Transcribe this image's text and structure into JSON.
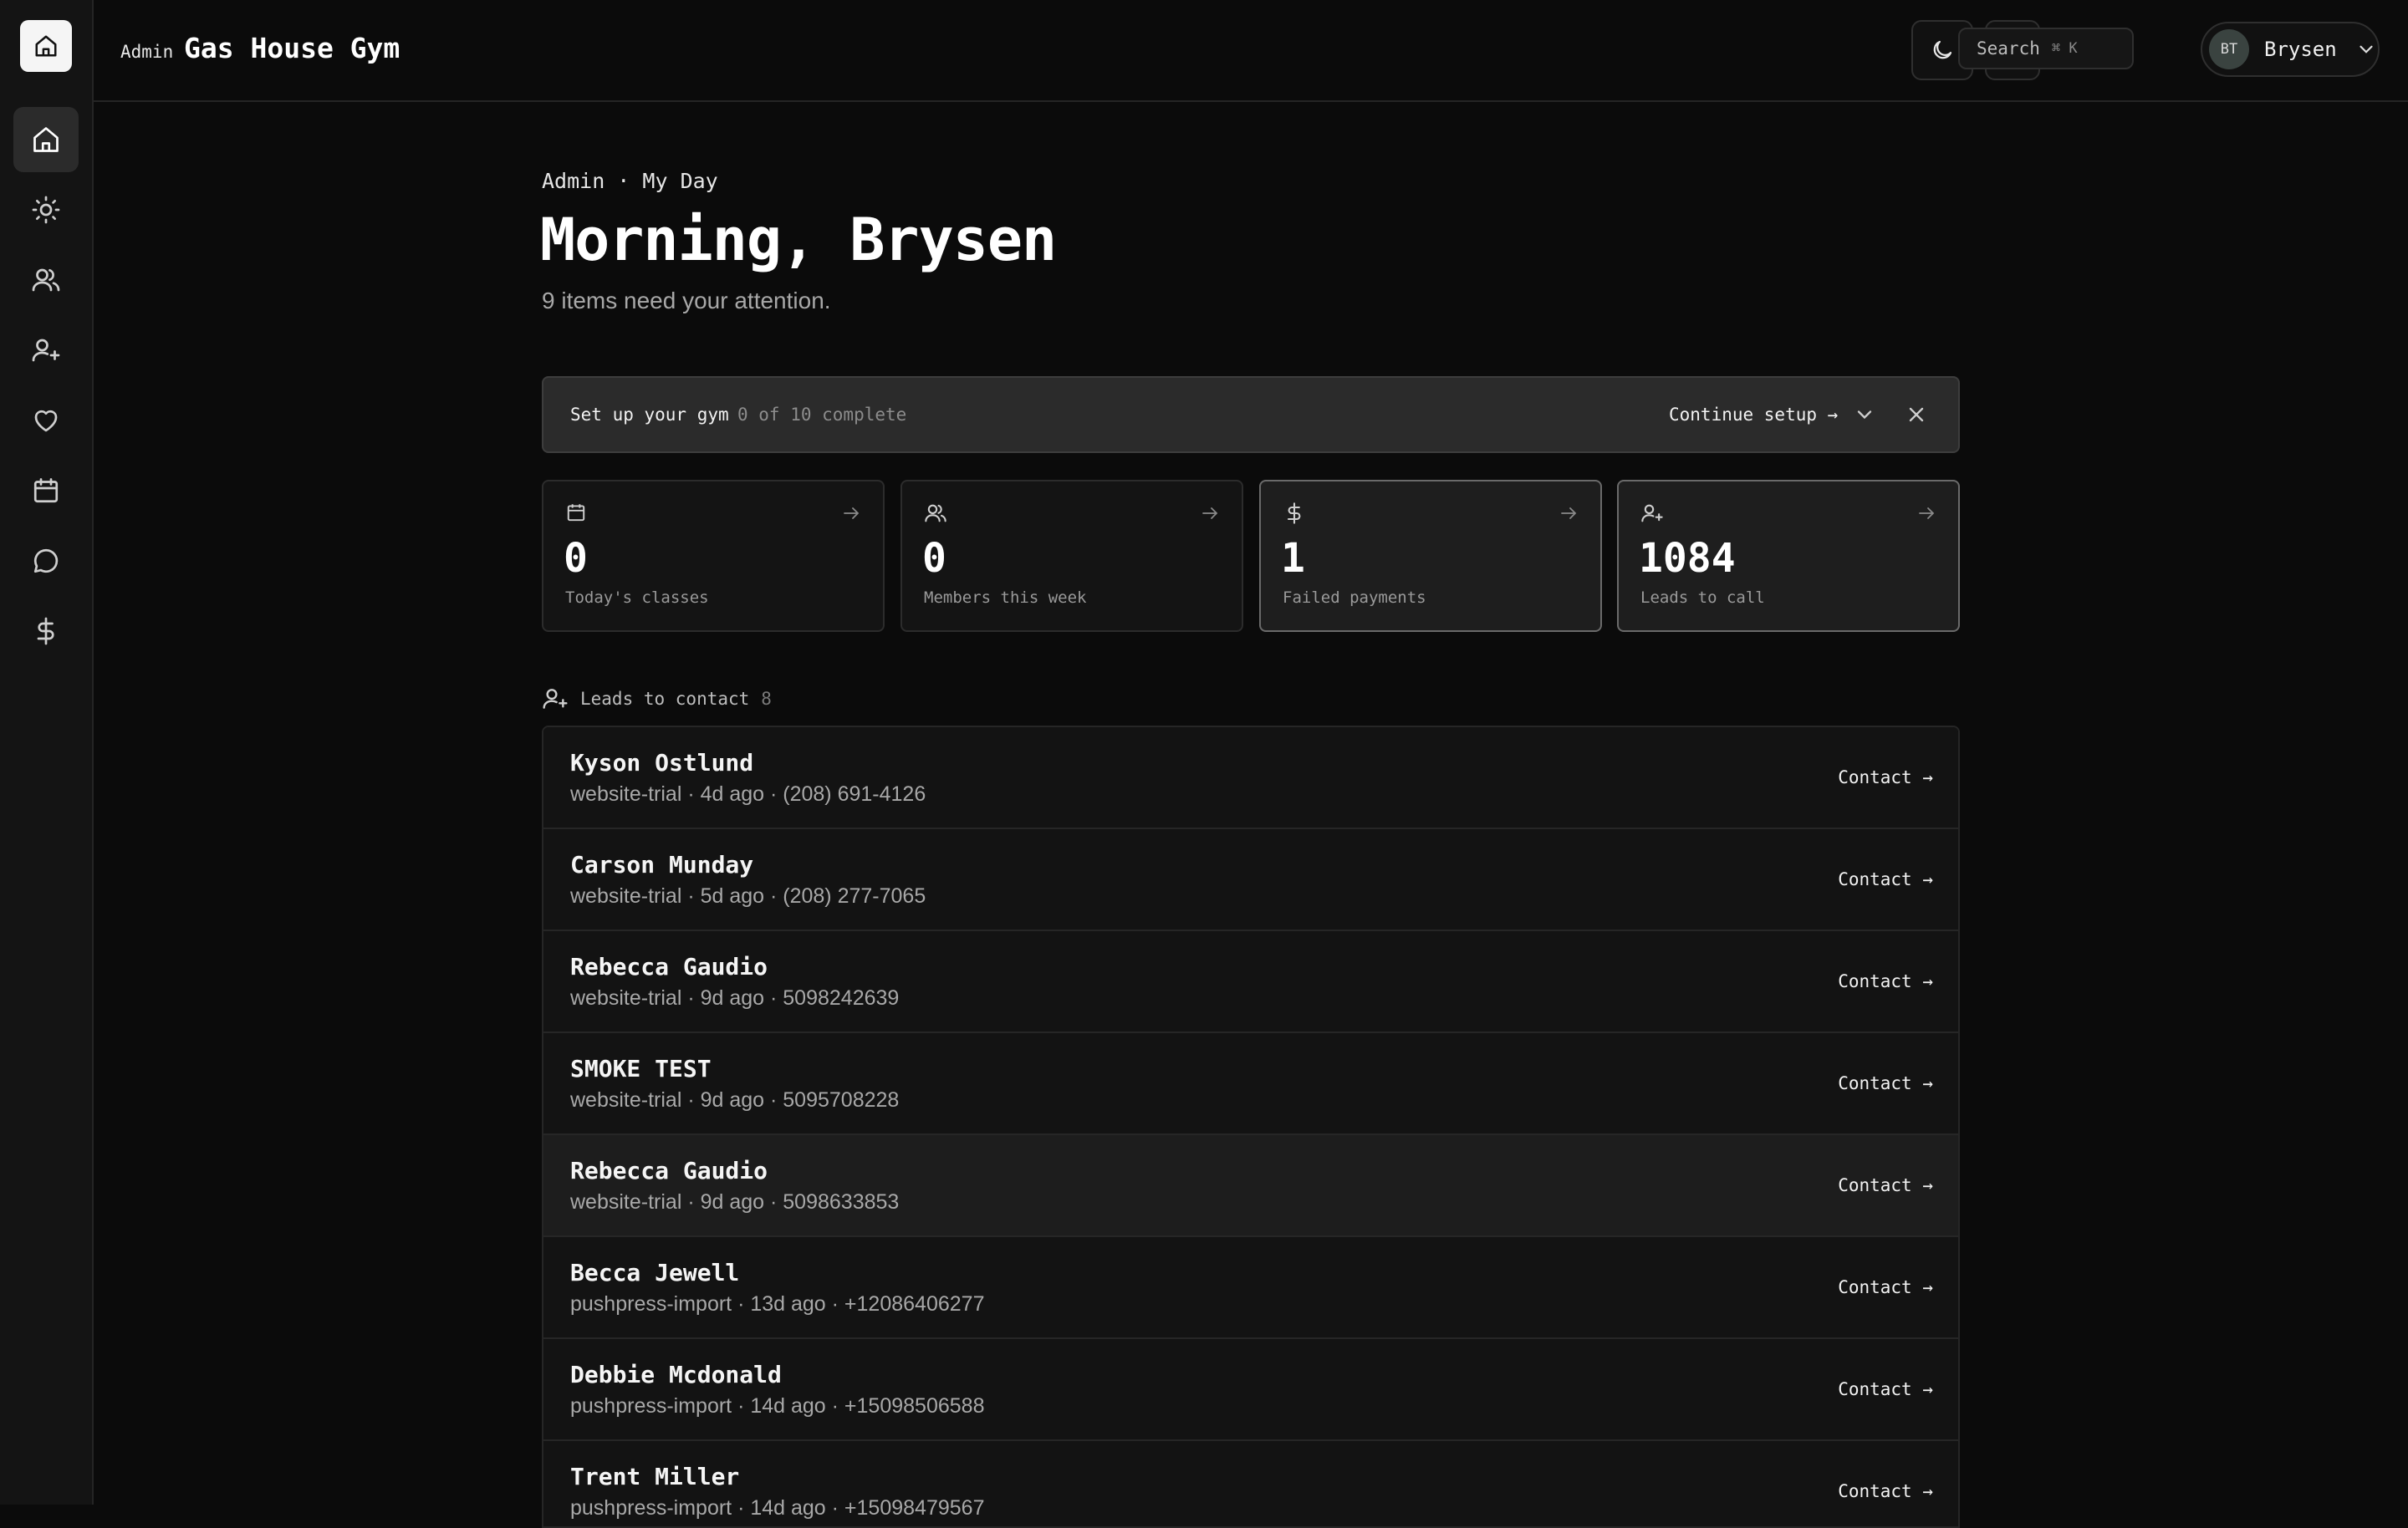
{
  "header": {
    "crumb": "Admin",
    "gym_name": "Gas House Gym",
    "search_label": "Search",
    "search_shortcut": "⌘ K",
    "user_initials": "BT",
    "user_name": "Brysen"
  },
  "sidebar": {
    "items": [
      {
        "name": "home",
        "icon": "home-icon",
        "active": true
      },
      {
        "name": "my-day",
        "icon": "sun-icon"
      },
      {
        "name": "members",
        "icon": "users-icon"
      },
      {
        "name": "leads",
        "icon": "user-plus-icon"
      },
      {
        "name": "retention",
        "icon": "heart-icon"
      },
      {
        "name": "schedule",
        "icon": "calendar-icon"
      },
      {
        "name": "messages",
        "icon": "chat-icon"
      },
      {
        "name": "billing",
        "icon": "dollar-icon"
      }
    ]
  },
  "page": {
    "eyebrow": "Admin · My Day",
    "greeting": "Morning, Brysen",
    "subtitle": "9 items need your attention."
  },
  "setup": {
    "title": "Set up your gym",
    "progress": "0 of 10 complete",
    "continue_label": "Continue setup →"
  },
  "stats": [
    {
      "value": "0",
      "label": "Today's classes",
      "icon": "calendar-icon"
    },
    {
      "value": "0",
      "label": "Members this week",
      "icon": "users-icon"
    },
    {
      "value": "1",
      "label": "Failed payments",
      "icon": "dollar-icon"
    },
    {
      "value": "1084",
      "label": "Leads to call",
      "icon": "user-plus-icon"
    }
  ],
  "leads": {
    "section_label": "Leads to contact",
    "count": "8",
    "contact_label": "Contact →",
    "items": [
      {
        "name": "Kyson Ostlund",
        "meta": "website-trial · 4d ago · (208) 691-4126"
      },
      {
        "name": "Carson Munday",
        "meta": "website-trial · 5d ago · (208) 277-7065"
      },
      {
        "name": "Rebecca Gaudio",
        "meta": "website-trial · 9d ago · 5098242639"
      },
      {
        "name": "SMOKE TEST",
        "meta": "website-trial · 9d ago · 5095708228"
      },
      {
        "name": "Rebecca Gaudio",
        "meta": "website-trial · 9d ago · 5098633853"
      },
      {
        "name": "Becca Jewell",
        "meta": "pushpress-import · 13d ago · +12086406277"
      },
      {
        "name": "Debbie Mcdonald",
        "meta": "pushpress-import · 14d ago · +15098506588"
      },
      {
        "name": "Trent Miller",
        "meta": "pushpress-import · 14d ago · +15098479567"
      }
    ]
  }
}
